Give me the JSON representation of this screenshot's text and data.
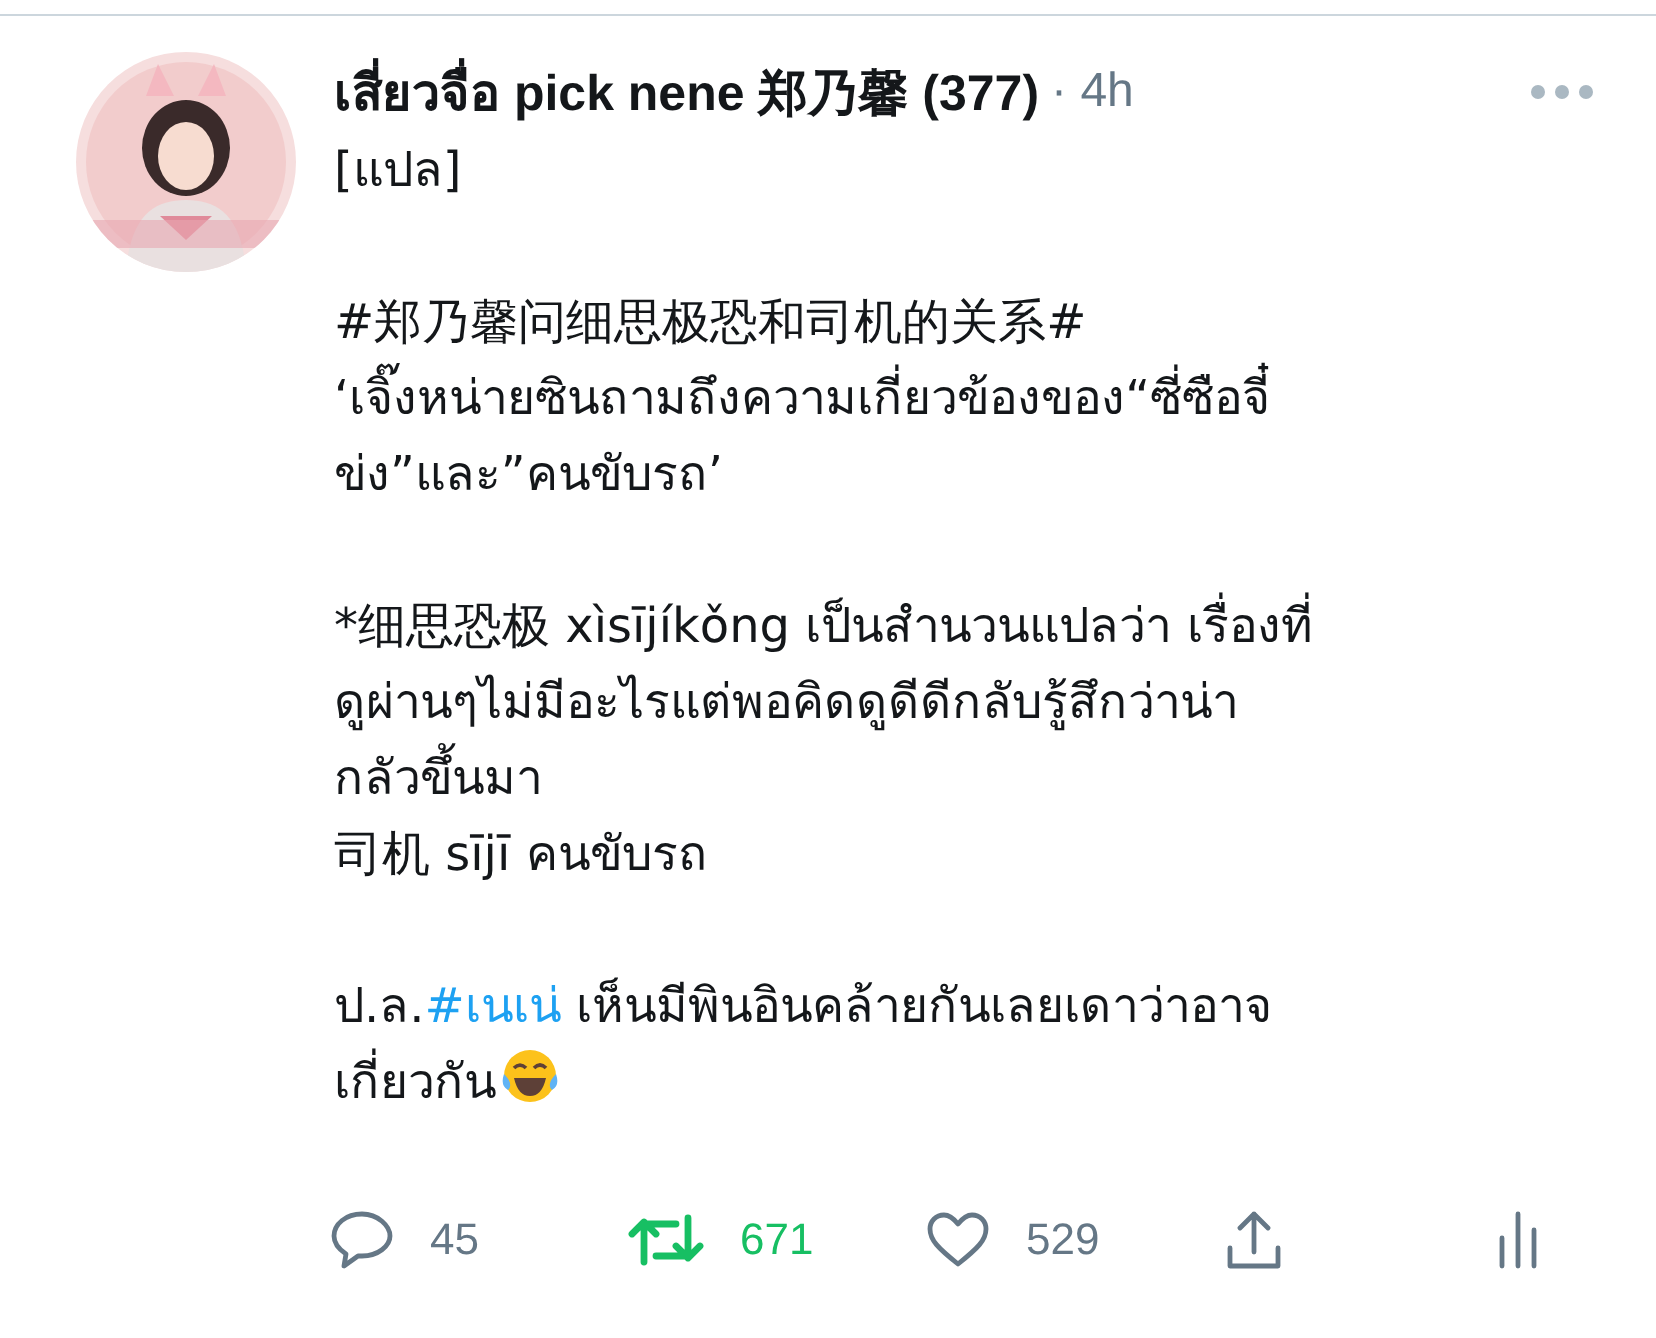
{
  "tweet": {
    "author": "เสี่ยวจื่อ pick nene 郑乃馨 (377)",
    "separator": "·",
    "time": "4h",
    "paragraphs": [
      {
        "lines": [
          "[แปล]"
        ]
      },
      {
        "lines": [
          "#郑乃馨问细思极恐和司机的关系#",
          "‘เจิ๊งหน่ายซินถามถึงความเกี่ยวข้องของ“ซี่ซือจี๋",
          "ข่ง”และ”คนขับรถ’"
        ]
      },
      {
        "lines": [
          "*细思恐极 xìsījíkǒng เป็นสำนวนแปลว่า เรื่องที่",
          "ดูผ่านๆไม่มีอะไรแต่พอคิดดูดีดีกลับรู้สึกว่าน่า",
          "กลัวขึ้นมา",
          "司机 sījī คนขับรถ"
        ]
      }
    ],
    "note": {
      "prefix": "ป.ล.",
      "hashtag": "#เนเน่",
      "text": " เห็นมีพินอินคล้ายกันเลยเดาว่าอาจ",
      "continuation": "เกี่ยวกัน"
    },
    "actions": [
      {
        "kind": "reply",
        "count": "45",
        "selected": false
      },
      {
        "kind": "retweet",
        "count": "671",
        "selected": true
      },
      {
        "kind": "like",
        "count": "529",
        "selected": false
      },
      {
        "kind": "share"
      },
      {
        "kind": "stats"
      }
    ]
  }
}
